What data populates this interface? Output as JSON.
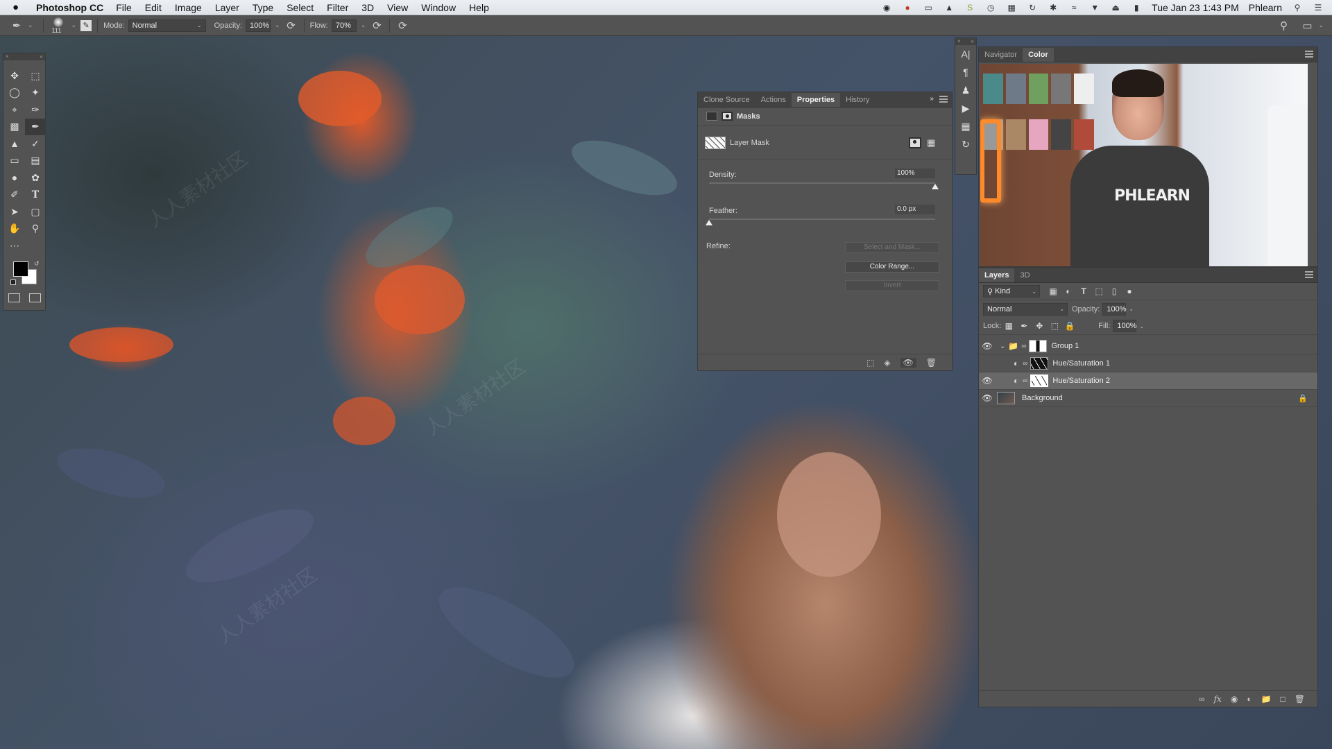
{
  "menubar": {
    "apple": "",
    "app_name": "Photoshop CC",
    "menus": [
      "File",
      "Edit",
      "Image",
      "Layer",
      "Type",
      "Select",
      "Filter",
      "3D",
      "View",
      "Window",
      "Help"
    ],
    "datetime": "Tue Jan 23  1:43 PM",
    "user": "Phlearn",
    "tray_icons": [
      "hp-icon",
      "creative-cloud-icon",
      "display-icon",
      "backup-icon",
      "s-app-icon",
      "clock-icon",
      "switcher-icon",
      "time-machine-icon",
      "bluetooth-icon",
      "wifi-icon",
      "airplay-icon",
      "eject-icon",
      "volume-icon"
    ]
  },
  "options_bar": {
    "tool": "brush-tool",
    "brush_size": "111",
    "mode_label": "Mode:",
    "mode_value": "Normal",
    "opacity_label": "Opacity:",
    "opacity_value": "100%",
    "flow_label": "Flow:",
    "flow_value": "70%"
  },
  "tools": {
    "items": [
      "move",
      "rectangular-marquee",
      "lasso",
      "magic-wand",
      "crop",
      "eyedropper",
      "healing-brush",
      "brush",
      "clone-stamp",
      "history-brush",
      "eraser",
      "gradient",
      "blur",
      "dodge",
      "pen",
      "type",
      "path-selection",
      "rectangle",
      "hand",
      "zoom",
      "edit-toolbar"
    ],
    "selected": "brush",
    "foreground_color": "#000000",
    "background_color": "#ffffff"
  },
  "properties_panel": {
    "tabs": [
      "Clone Source",
      "Actions",
      "Properties",
      "History"
    ],
    "active_tab": "Properties",
    "section": "Masks",
    "mask_label": "Layer Mask",
    "density_label": "Density:",
    "density_value": "100%",
    "density_fraction": 1.0,
    "feather_label": "Feather:",
    "feather_value": "0.0 px",
    "feather_fraction": 0.0,
    "refine_label": "Refine:",
    "buttons": {
      "select_and_mask": "Select and Mask...",
      "color_range": "Color Range...",
      "invert": "Invert"
    }
  },
  "navigator_panel": {
    "tabs": [
      "Navigator",
      "Color"
    ],
    "active_tab": "Color",
    "shirt_text": "PHLEARN"
  },
  "layers_panel": {
    "tabs": [
      "Layers",
      "3D"
    ],
    "active_tab": "Layers",
    "filter_label": "Kind",
    "blend_mode": "Normal",
    "opacity_label": "Opacity:",
    "opacity_value": "100%",
    "lock_label": "Lock:",
    "fill_label": "Fill:",
    "fill_value": "100%",
    "layers": [
      {
        "name": "Group 1",
        "type": "group",
        "visible": true,
        "expanded": true,
        "selected": false
      },
      {
        "name": "Hue/Saturation 1",
        "type": "adjustment",
        "visible": false,
        "selected": false
      },
      {
        "name": "Hue/Saturation 2",
        "type": "adjustment",
        "visible": true,
        "selected": true
      },
      {
        "name": "Background",
        "type": "pixel",
        "visible": true,
        "locked": true,
        "selected": false
      }
    ]
  },
  "watermark_text": "人人素材社区"
}
